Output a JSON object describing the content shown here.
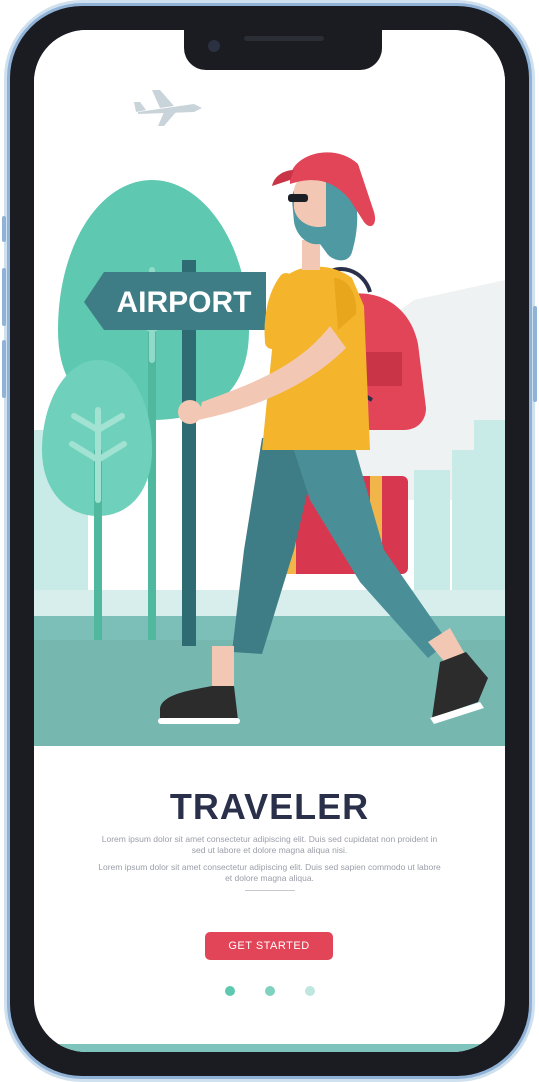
{
  "illustration": {
    "sign_text": "AIRPORT"
  },
  "onboarding": {
    "title": "TRAVELER",
    "paragraph_1": "Lorem ipsum dolor sit amet consectetur adipiscing elit. Duis sed cupidatat non proident in sed ut labore et dolore magna aliqua nisi.",
    "paragraph_2": "Lorem ipsum dolor sit amet consectetur adipiscing elit. Duis sed sapien commodo ut labore et dolore magna aliqua.",
    "cta_label": "GET STARTED"
  },
  "pagination": {
    "total": 3,
    "active_index": 0
  },
  "colors": {
    "accent": "#e24458",
    "title": "#2a2f4a",
    "teal": "#5ec9b0",
    "frame_blue": "#8fb2d6"
  },
  "icons": [
    "airplane-icon",
    "camera-icon"
  ]
}
